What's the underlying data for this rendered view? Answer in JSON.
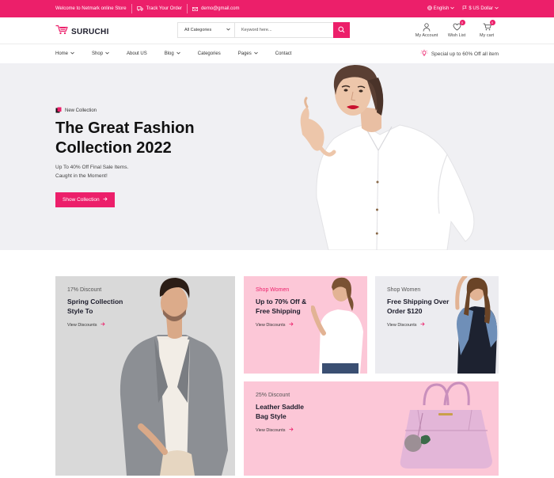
{
  "topbar": {
    "welcome": "Welcome to Netmark online Store",
    "track": "Track Your Order",
    "email": "demo@gmail.com",
    "language": "English",
    "currency": "$ US Dollar",
    "bg_color": "#ec1f6a"
  },
  "header": {
    "logo_text": "SURUCHI",
    "search": {
      "category": "All Categories",
      "placeholder": "Keyword here..."
    },
    "icons": [
      {
        "label": "My Account",
        "icon": "user-icon"
      },
      {
        "label": "Wish List",
        "icon": "heart-icon",
        "badge": "0"
      },
      {
        "label": "My cart",
        "icon": "cart-icon",
        "badge": "0"
      }
    ]
  },
  "nav": {
    "items": [
      {
        "label": "Home",
        "dropdown": true
      },
      {
        "label": "Shop",
        "dropdown": true
      },
      {
        "label": "About US",
        "dropdown": false
      },
      {
        "label": "Blog",
        "dropdown": true
      },
      {
        "label": "Categories",
        "dropdown": false
      },
      {
        "label": "Pages",
        "dropdown": true
      },
      {
        "label": "Contact",
        "dropdown": false
      }
    ],
    "special": "Special up to 60% Off all item"
  },
  "hero": {
    "tag": "New Collection",
    "title_line1": "The Great Fashion",
    "title_line2": "Collection 2022",
    "sub_line1": "Up To 40% Off Final Sale Items.",
    "sub_line2": "Caught in the Moment!",
    "button": "Show Collection"
  },
  "banners": [
    {
      "caption": "17% Discount",
      "title_line1": "Spring Collection",
      "title_line2": "Style To",
      "link": "View Discounts"
    },
    {
      "caption": "Shop Women",
      "title_line1": "Up to 70% Off &",
      "title_line2": "Free Shipping",
      "link": "View Discounts"
    },
    {
      "caption": "Shop Women",
      "title_line1": "Free Shipping Over",
      "title_line2": "Order $120",
      "link": "View Discounts"
    },
    {
      "caption": "25% Discount",
      "title_line1": "Leather Saddle",
      "title_line2": "Bag Style",
      "link": "View Discounts"
    }
  ],
  "colors": {
    "accent": "#ec1f6a",
    "pink_bg": "#fcc7d7",
    "hero_bg": "#f0f0f3"
  }
}
